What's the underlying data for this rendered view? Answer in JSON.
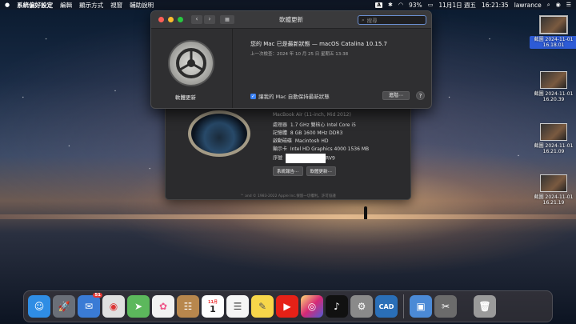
{
  "menubar": {
    "app_name": "系統偏好設定",
    "items": [
      "編輯",
      "顯示方式",
      "視窗",
      "輔助說明"
    ],
    "input_source": "A",
    "battery": "93%",
    "date": "11月1日 週五",
    "time": "16:21:35",
    "user": "lawrance"
  },
  "software_update": {
    "title": "軟體更新",
    "search_placeholder": "搜尋",
    "icon_label": "軟體更新",
    "status": "您的 Mac 已是最新狀態 — macOS Catalina 10.15.7",
    "last_check": "上一次檢查：2024 年 10 月 25 日 星期五 13:38",
    "auto_update_label": "讓我的 Mac 自動保持最新狀態",
    "auto_update_checked": true,
    "advanced_label": "進階⋯",
    "help_label": "?"
  },
  "about_mac": {
    "model": "MacBook Air (11-inch, Mid 2012)",
    "rows": [
      {
        "label": "處理器",
        "value": "1.7 GHz 雙核心 Intel Core i5"
      },
      {
        "label": "記憶體",
        "value": "8 GB 1600 MHz DDR3"
      },
      {
        "label": "啟動磁碟",
        "value": "Macintosh HD"
      },
      {
        "label": "顯示卡",
        "value": "Intel HD Graphics 4000 1536 MB"
      }
    ],
    "serial_label": "序號",
    "serial_suffix": "RV9",
    "system_report_label": "系統報告⋯",
    "software_update_label": "軟體更新⋯",
    "copyright": "™ and © 1983-2022 Apple Inc.保留一切權利。許可協議"
  },
  "desktop_files": [
    {
      "name_line1": "截圖 2024-11-01",
      "name_line2": "16.18.01",
      "selected": true
    },
    {
      "name_line1": "截圖 2024-11-01",
      "name_line2": "16.20.39",
      "selected": false
    },
    {
      "name_line1": "截圖 2024-11-01",
      "name_line2": "16.21.09",
      "selected": false
    },
    {
      "name_line1": "截圖 2024-11-01",
      "name_line2": "16.21.19",
      "selected": false
    }
  ],
  "dock": {
    "apps": [
      {
        "name": "finder",
        "glyph": "☺",
        "color": "#2f8de4"
      },
      {
        "name": "launchpad",
        "glyph": "🚀",
        "color": "#6a6f78"
      },
      {
        "name": "mail",
        "glyph": "✉",
        "color": "#3a7bd5",
        "badge": "51"
      },
      {
        "name": "chrome",
        "glyph": "◉",
        "color": "#e0e0e0"
      },
      {
        "name": "maps",
        "glyph": "➤",
        "color": "#5cb85c"
      },
      {
        "name": "photos",
        "glyph": "✿",
        "color": "#f2f2f2"
      },
      {
        "name": "contacts",
        "glyph": "☷",
        "color": "#b8874d"
      },
      {
        "name": "calendar",
        "glyph": "1",
        "color": "#ffffff"
      },
      {
        "name": "reminders",
        "glyph": "☰",
        "color": "#f5f5f5"
      },
      {
        "name": "notes",
        "glyph": "✎",
        "color": "#f7d64a"
      },
      {
        "name": "youtube",
        "glyph": "▶",
        "color": "#e62117"
      },
      {
        "name": "instagram",
        "glyph": "◎",
        "color": "#d6249f"
      },
      {
        "name": "tiktok",
        "glyph": "♪",
        "color": "#111111"
      },
      {
        "name": "system-preferences",
        "glyph": "⚙",
        "color": "#8a8a8a"
      },
      {
        "name": "cad",
        "glyph": "CAD",
        "color": "#2a6fb8"
      },
      {
        "name": "preview",
        "glyph": "▣",
        "color": "#4b8ad6"
      },
      {
        "name": "screenshot",
        "glyph": "✂",
        "color": "#6b6b6b"
      },
      {
        "name": "trash",
        "glyph": "🗑",
        "color": "#9a9a9a"
      }
    ],
    "calendar_month": "11月"
  }
}
